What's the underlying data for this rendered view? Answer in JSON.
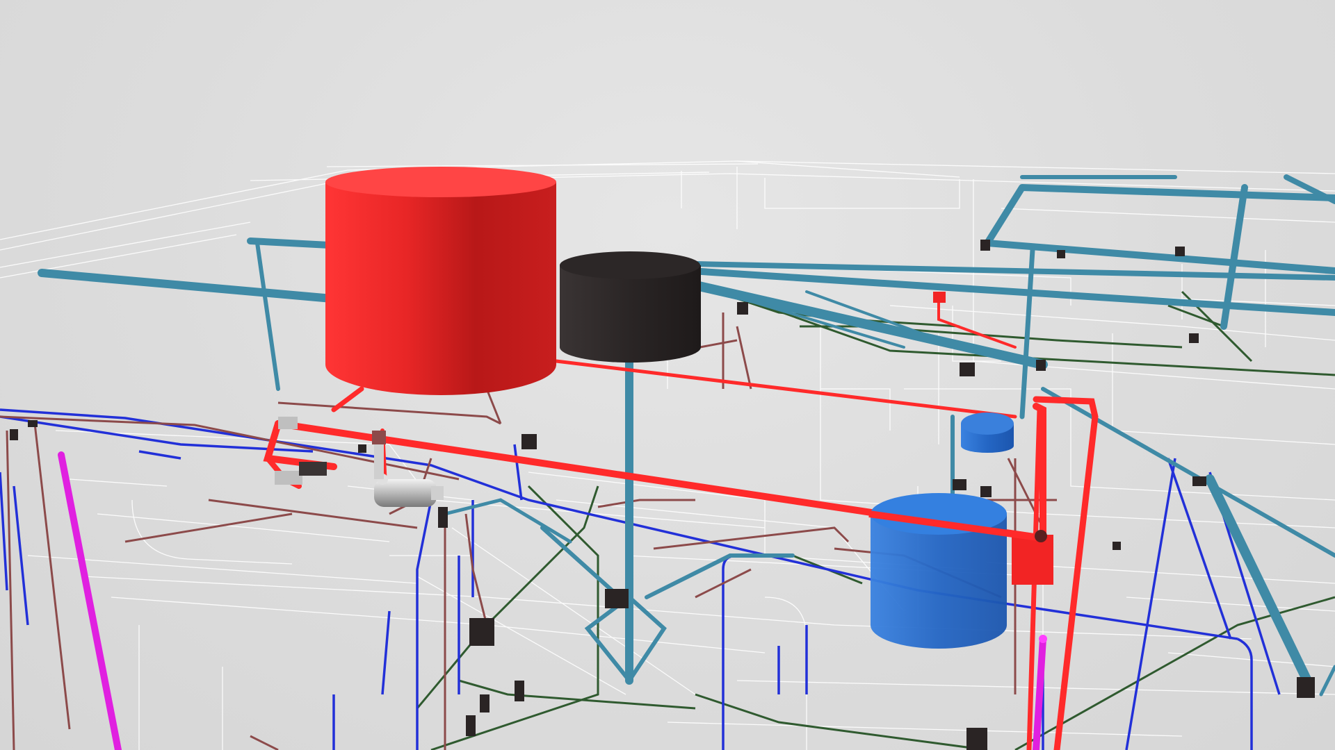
{
  "viewer": {
    "background": "#dcdcdc",
    "mode": "3d-mep-model"
  },
  "colors": {
    "cold_water": "#3f8aa6",
    "hot_water_supply": "#ff2a2a",
    "hot_water_return": "#8c4a4a",
    "drain": "#2230d8",
    "gas": "#2f5a2f",
    "fire": "#e020e0",
    "floor_lines": "#ffffff",
    "tank_red": "#d82222",
    "tank_black": "#2b2727",
    "tank_blue": "#2a70d0",
    "fittings": "#2a2424"
  },
  "objects": [
    {
      "name": "red-storage-tank",
      "kind": "tank",
      "color": "tank_red"
    },
    {
      "name": "black-storage-tank",
      "kind": "tank",
      "color": "tank_black"
    },
    {
      "name": "blue-small-tank",
      "kind": "tank",
      "color": "tank_blue"
    },
    {
      "name": "blue-large-tank",
      "kind": "tank",
      "color": "tank_blue"
    },
    {
      "name": "pump",
      "kind": "equipment",
      "color": "silver"
    },
    {
      "name": "red-heater-box",
      "kind": "equipment",
      "color": "hot_water_supply"
    }
  ],
  "systems": [
    "cold-water",
    "hot-water-supply",
    "hot-water-return",
    "drain",
    "gas",
    "fire-line",
    "floor-plan"
  ]
}
